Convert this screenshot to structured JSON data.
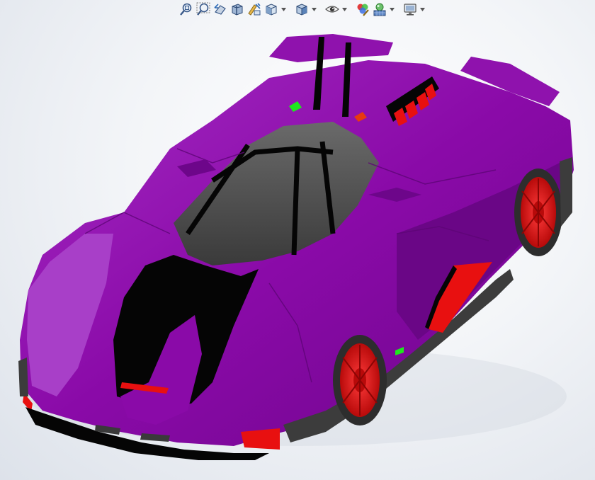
{
  "toolbar": {
    "tools": [
      {
        "id": "zoom-to-fit",
        "icon": "zoom-to-fit-icon"
      },
      {
        "id": "zoom-to-area",
        "icon": "zoom-to-area-icon"
      },
      {
        "id": "previous-view",
        "icon": "previous-view-icon"
      },
      {
        "id": "section-view",
        "icon": "section-view-icon"
      },
      {
        "id": "dynamic-annotation-views",
        "icon": "dynamic-annotation-icon"
      },
      {
        "id": "view-orientation",
        "icon": "view-orientation-icon",
        "dropdown": true
      },
      {
        "id": "display-style",
        "icon": "display-style-icon",
        "dropdown": true
      },
      {
        "id": "hide-show-items",
        "icon": "hide-show-eye-icon",
        "dropdown": true
      },
      {
        "id": "edit-appearance",
        "icon": "edit-appearance-icon"
      },
      {
        "id": "apply-scene",
        "icon": "apply-scene-icon",
        "dropdown": true
      },
      {
        "id": "view-settings",
        "icon": "view-settings-monitor-icon",
        "dropdown": true
      }
    ]
  },
  "colors": {
    "body_purple": "#8a0aa8",
    "body_purple_dark": "#5e0577",
    "body_purple_light": "#a830c6",
    "canopy_gray": "#4a4a4a",
    "wheel_red": "#e81010",
    "tire_gray": "#3c3c3c",
    "trim_black": "#050505",
    "light_green": "#1ee81e"
  }
}
